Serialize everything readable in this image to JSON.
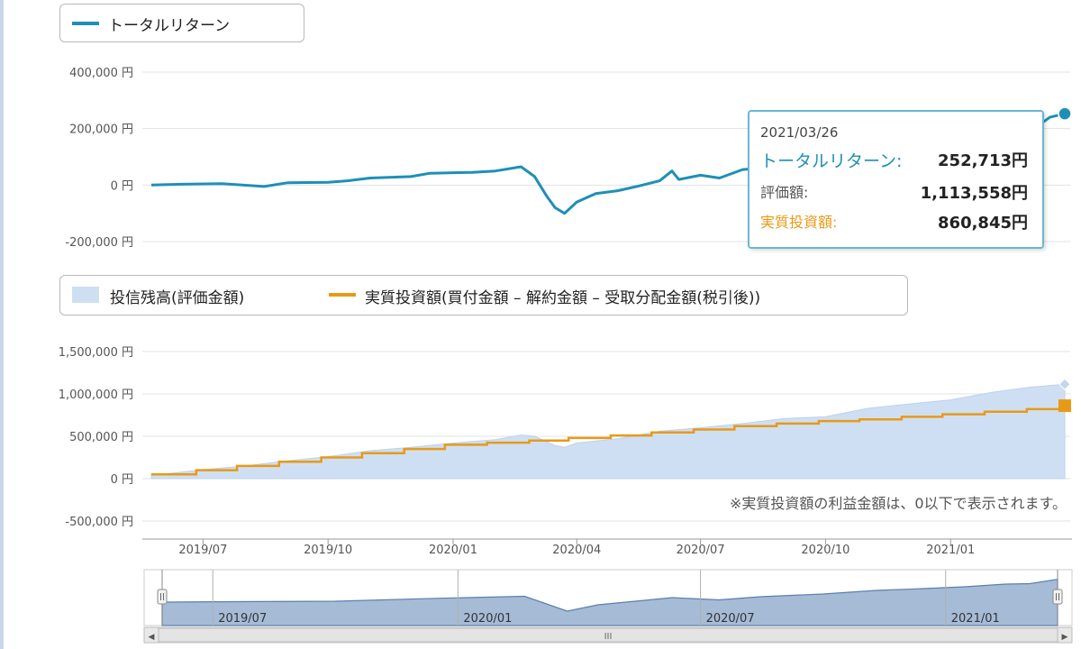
{
  "colors": {
    "total_return": "#1e8fb8",
    "balance_fill": "#cfdff3",
    "balance_line": "#bcd2ee",
    "invested": "#e89a16",
    "grid": "#e3e3e3",
    "axis_text": "#555555",
    "navigator_fill": "#a6bbd6",
    "navigator_line": "#5c7fae"
  },
  "legend_top": {
    "items": [
      {
        "label": "トータルリターン",
        "icon": "line-swatch-blue-icon"
      }
    ]
  },
  "legend_middle": {
    "items": [
      {
        "label": "投信残高(評価金額)",
        "icon": "area-swatch-lightblue-icon"
      },
      {
        "label": "実質投資額(買付金額 – 解約金額 – 受取分配金額(税引後))",
        "icon": "line-swatch-orange-icon"
      }
    ]
  },
  "tooltip": {
    "date": "2021/03/26",
    "rows": [
      {
        "label": "トータルリターン:",
        "value": "252,713円",
        "color": "#1e8fb8"
      },
      {
        "label": "評価額:",
        "value": "1,113,558円",
        "color": "#555555"
      },
      {
        "label": "実質投資額:",
        "value": "860,845円",
        "color": "#e89a16"
      }
    ]
  },
  "note": "※実質投資額の利益金額は、0以下で表示されます。",
  "navigator": {
    "scroll_handle": "III",
    "left_arrow": "◀",
    "right_arrow": "▶"
  },
  "chart_data": [
    {
      "type": "line",
      "ylim": [
        -200000,
        400000
      ],
      "y_ticks": [
        400000,
        200000,
        0,
        -200000
      ],
      "y_tick_labels": [
        "400,000 円",
        "200,000 円",
        "0 円",
        "-200,000 円"
      ],
      "xlim": [
        "2019-05-24",
        "2021-03-26"
      ],
      "series": [
        {
          "name": "トータルリターン",
          "x": [
            "2019-05-24",
            "2019-06-15",
            "2019-07-15",
            "2019-08-15",
            "2019-09-01",
            "2019-10-01",
            "2019-10-15",
            "2019-11-01",
            "2019-12-01",
            "2019-12-15",
            "2020-01-15",
            "2020-02-01",
            "2020-02-20",
            "2020-03-01",
            "2020-03-10",
            "2020-03-16",
            "2020-03-23",
            "2020-04-01",
            "2020-04-15",
            "2020-05-01",
            "2020-05-15",
            "2020-06-01",
            "2020-06-10",
            "2020-06-15",
            "2020-07-01",
            "2020-07-15",
            "2020-08-01",
            "2020-08-15",
            "2020-09-01",
            "2020-09-15",
            "2020-10-01",
            "2020-10-15",
            "2020-11-01",
            "2020-11-10",
            "2020-12-01",
            "2020-12-15",
            "2021-01-01",
            "2021-01-15",
            "2021-02-01",
            "2021-02-15",
            "2021-02-25",
            "2021-03-05",
            "2021-03-15",
            "2021-03-26"
          ],
          "y": [
            0,
            3000,
            5000,
            -5000,
            8000,
            10000,
            15000,
            25000,
            30000,
            42000,
            45000,
            50000,
            65000,
            30000,
            -40000,
            -80000,
            -100000,
            -60000,
            -30000,
            -20000,
            -5000,
            15000,
            50000,
            20000,
            35000,
            25000,
            55000,
            60000,
            75000,
            60000,
            90000,
            80000,
            115000,
            130000,
            145000,
            150000,
            155000,
            170000,
            185000,
            200000,
            215000,
            205000,
            240000,
            252713
          ]
        }
      ]
    },
    {
      "type": "area",
      "ylim": [
        -500000,
        1500000
      ],
      "y_ticks": [
        1500000,
        1000000,
        500000,
        0,
        -500000
      ],
      "y_tick_labels": [
        "1,500,000 円",
        "1,000,000 円",
        "500,000 円",
        "0 円",
        "-500,000 円"
      ],
      "xlim": [
        "2019-05-24",
        "2021-03-26"
      ],
      "x_ticks": [
        "2019-07-01",
        "2019-10-01",
        "2020-01-01",
        "2020-04-01",
        "2020-07-01",
        "2020-10-01",
        "2021-01-01"
      ],
      "x_tick_labels": [
        "2019/07",
        "2019/10",
        "2020/01",
        "2020/04",
        "2020/07",
        "2020/10",
        "2021/01"
      ],
      "series": [
        {
          "name": "投信残高(評価金額)",
          "type": "area",
          "x": [
            "2019-05-24",
            "2019-06-01",
            "2019-07-01",
            "2019-08-01",
            "2019-09-01",
            "2019-10-01",
            "2019-11-01",
            "2019-12-01",
            "2020-01-01",
            "2020-02-01",
            "2020-02-20",
            "2020-03-01",
            "2020-03-16",
            "2020-03-23",
            "2020-04-01",
            "2020-05-01",
            "2020-06-01",
            "2020-07-01",
            "2020-08-01",
            "2020-09-01",
            "2020-10-01",
            "2020-11-01",
            "2020-12-01",
            "2021-01-01",
            "2021-02-01",
            "2021-03-01",
            "2021-03-26"
          ],
          "y": [
            50000,
            52000,
            105000,
            150000,
            210000,
            260000,
            330000,
            370000,
            420000,
            460000,
            515000,
            500000,
            390000,
            370000,
            420000,
            470000,
            560000,
            600000,
            650000,
            710000,
            730000,
            830000,
            880000,
            930000,
            1020000,
            1080000,
            1113558
          ]
        },
        {
          "name": "実質投資額(買付金額 – 解約金額 – 受取分配金額(税引後))",
          "type": "step",
          "x": [
            "2019-05-24",
            "2019-06-26",
            "2019-07-26",
            "2019-08-26",
            "2019-09-26",
            "2019-10-26",
            "2019-11-26",
            "2019-12-26",
            "2020-01-26",
            "2020-02-26",
            "2020-03-26",
            "2020-04-26",
            "2020-05-26",
            "2020-06-26",
            "2020-07-26",
            "2020-08-26",
            "2020-09-26",
            "2020-10-26",
            "2020-11-26",
            "2020-12-26",
            "2021-01-26",
            "2021-02-26",
            "2021-03-26"
          ],
          "y": [
            50000,
            100000,
            150000,
            200000,
            250000,
            300000,
            350000,
            400000,
            425000,
            450000,
            480000,
            510000,
            545000,
            580000,
            620000,
            650000,
            680000,
            700000,
            730000,
            760000,
            790000,
            820000,
            860845
          ]
        }
      ]
    },
    {
      "type": "area",
      "xlim": [
        "2019-05-24",
        "2021-03-26"
      ],
      "x_ticks": [
        "2019-07-01",
        "2020-01-01",
        "2020-07-01",
        "2021-01-01"
      ],
      "x_tick_labels": [
        "2019/07",
        "2020/01",
        "2020/07",
        "2021/01"
      ],
      "series": [
        {
          "x": [
            "2019-05-24",
            "2019-07-15",
            "2019-10-01",
            "2019-12-15",
            "2020-02-20",
            "2020-03-23",
            "2020-04-15",
            "2020-06-10",
            "2020-07-15",
            "2020-08-15",
            "2020-10-01",
            "2020-11-10",
            "2020-12-15",
            "2021-01-15",
            "2021-02-15",
            "2021-03-05",
            "2021-03-26"
          ],
          "y": [
            0,
            5000,
            10000,
            42000,
            65000,
            -100000,
            -30000,
            50000,
            25000,
            60000,
            90000,
            130000,
            150000,
            170000,
            200000,
            205000,
            252713
          ]
        }
      ]
    }
  ]
}
